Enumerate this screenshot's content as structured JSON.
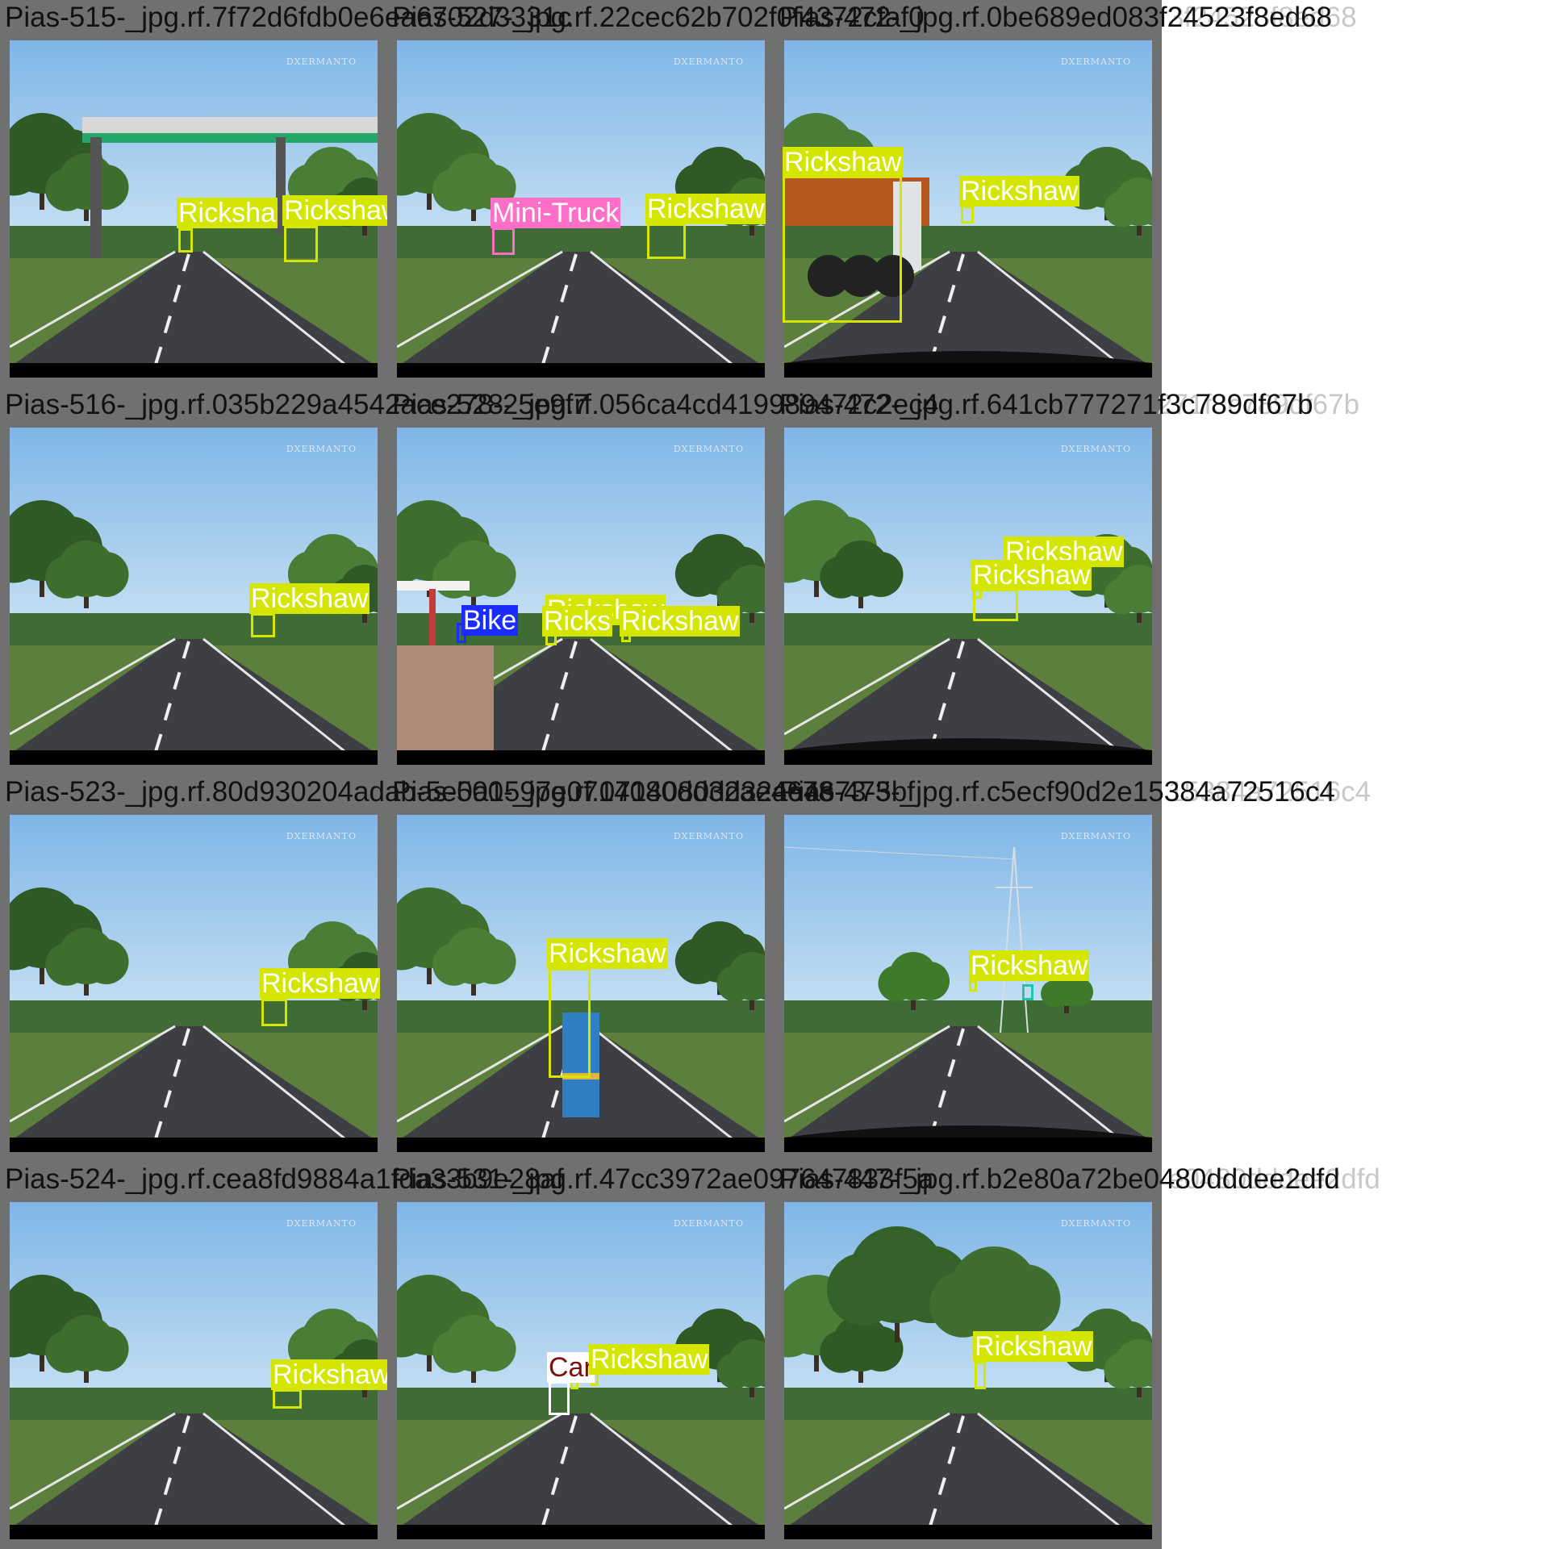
{
  "colors": {
    "Rickshaw": "#d4e600",
    "Mini-Truck": "#ff6ec7",
    "Bike": "#1a2cff",
    "Car": "#ffffff",
    "Teal": "#22c4a8"
  },
  "tiles": [
    {
      "title": "Pias-515-_jpg.rf.7f72d6fdb0e6ea6702d3331c",
      "scene": "overpass",
      "detections": [
        {
          "label": "Rickshaw",
          "text": "Ricksha"
        },
        {
          "label": "Rickshaw",
          "text": "Rickshaw"
        }
      ]
    },
    {
      "title": "Pias-527-_jpg.rf.22cec62b702f0f4372cfaf0",
      "scene": "road",
      "detections": [
        {
          "label": "Mini-Truck",
          "text": "Mini-Truck"
        },
        {
          "label": "Rickshaw",
          "text": "Rickshaw"
        }
      ]
    },
    {
      "title": "Pias-472-_jpg.rf.0be689ed083f24523f8ed68",
      "scene": "truck",
      "detections": [
        {
          "label": "Rickshaw",
          "text": "Rickshaw"
        },
        {
          "label": "Rickshaw",
          "text": "Rickshaw"
        }
      ]
    },
    {
      "title": "Pias-516-_jpg.rf.035b229a4542ace278-25e9f7",
      "scene": "road",
      "detections": [
        {
          "label": "Rickshaw",
          "text": "Rickshaw"
        }
      ]
    },
    {
      "title": "Pias-528-_jpg.rf.056ca4cd419989472c2ec4",
      "scene": "station",
      "detections": [
        {
          "label": "Rickshaw",
          "text": "Ricks"
        },
        {
          "label": "Rickshaw",
          "text": "Rickshaw"
        },
        {
          "label": "Bike",
          "text": "Bike"
        }
      ]
    },
    {
      "title": "Pias-472-_jpg.rf.641cb777271f3c789df67b",
      "scene": "road",
      "detections": [
        {
          "label": "Rickshaw",
          "text": "Rickshaw"
        },
        {
          "label": "Rickshaw",
          "text": "Rickshaw"
        }
      ]
    },
    {
      "title": "Pias-523-_jpg.rf.80d930204adab-5e0a1597e0714080dd32ae4678",
      "scene": "road",
      "detections": [
        {
          "label": "Rickshaw",
          "text": "Rickshaw"
        }
      ]
    },
    {
      "title": "Pias-500-_jpg.rf.0714080dd32ae4673-5bf",
      "scene": "truck-road",
      "detections": [
        {
          "label": "Rickshaw",
          "text": "Rickshaw"
        }
      ]
    },
    {
      "title": "Pias-473-_jpg.rf.c5ecf90d2e15384a72516c4",
      "scene": "pylon",
      "detections": [
        {
          "label": "Rickshaw",
          "text": "Rickshaw"
        }
      ]
    },
    {
      "title": "Pias-524-_jpg.rf.cea8fd9884a1fda33b9e28af",
      "scene": "road",
      "detections": [
        {
          "label": "Rickshaw",
          "text": "Rickshaw"
        }
      ]
    },
    {
      "title": "Pias-531-_jpg.rf.47cc3972ae097647833f5a",
      "scene": "road",
      "detections": [
        {
          "label": "Car",
          "text": "Car"
        },
        {
          "label": "Rickshaw",
          "text": "Rickshaw"
        }
      ]
    },
    {
      "title": "Pias-447-_jpg.rf.b2e80a72be0480dddee2dfd",
      "scene": "trees",
      "detections": [
        {
          "label": "Rickshaw",
          "text": "Rickshaw"
        }
      ]
    }
  ],
  "tails": [
    "3f24523f8ed68",
    "271f3c789df67b",
    "15384a72516c4",
    "e0480dddee2dfd"
  ],
  "watermark": "DXERMANTO"
}
